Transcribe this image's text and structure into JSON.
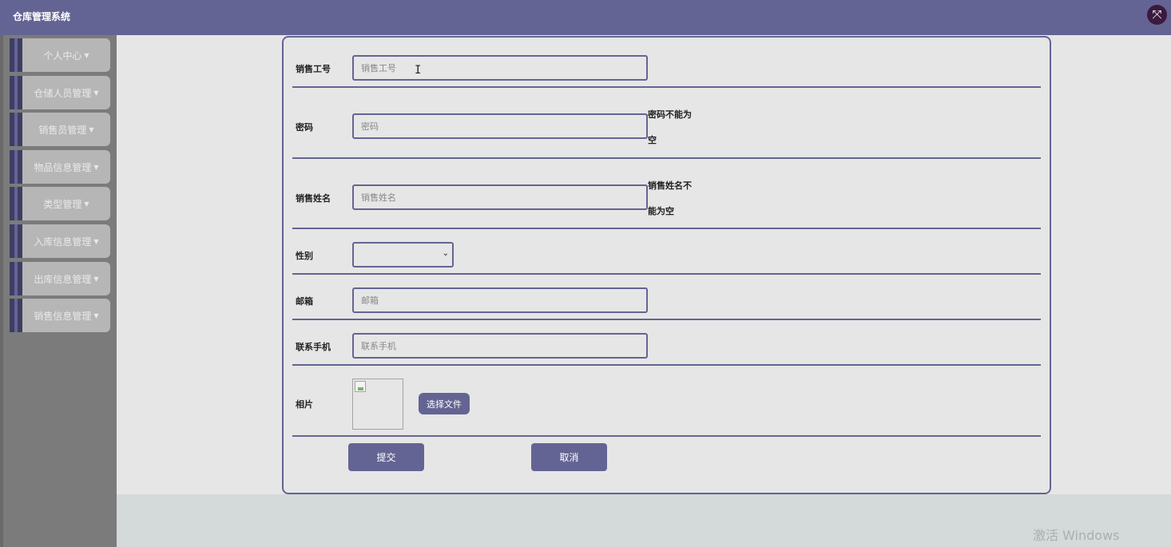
{
  "app": {
    "title": "仓库管理系统",
    "close_icon": "⤧"
  },
  "sidebar": {
    "items": [
      {
        "label": "个人中心"
      },
      {
        "label": "仓储人员管理"
      },
      {
        "label": "销售员管理"
      },
      {
        "label": "物品信息管理"
      },
      {
        "label": "类型管理"
      },
      {
        "label": "入库信息管理"
      },
      {
        "label": "出库信息管理"
      },
      {
        "label": "销售信息管理"
      }
    ]
  },
  "form": {
    "sales_id": {
      "label": "销售工号",
      "placeholder": "销售工号",
      "value": ""
    },
    "password": {
      "label": "密码",
      "placeholder": "密码",
      "value": "",
      "error_line1": "密码不能为",
      "error_line2": "空"
    },
    "sales_name": {
      "label": "销售姓名",
      "placeholder": "销售姓名",
      "value": "",
      "error_line1": "销售姓名不",
      "error_line2": "能为空"
    },
    "gender": {
      "label": "性别",
      "value": ""
    },
    "email": {
      "label": "邮箱",
      "placeholder": "邮箱",
      "value": ""
    },
    "phone": {
      "label": "联系手机",
      "placeholder": "联系手机",
      "value": ""
    },
    "photo": {
      "label": "相片",
      "choose_file": "选择文件"
    },
    "submit": "提交",
    "cancel": "取消"
  },
  "watermark": "激活 Windows",
  "colors": {
    "accent": "#646494",
    "main_bg": "#e6e6e6",
    "sidebar_bg": "#7b7b7b"
  }
}
